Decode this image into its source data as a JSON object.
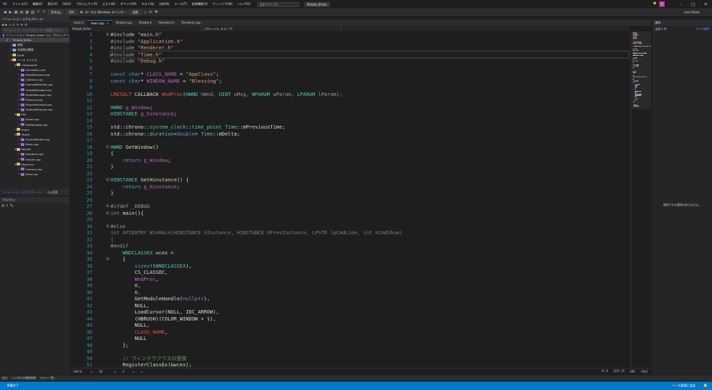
{
  "titlebar": {
    "menus": [
      "ファイル(F)",
      "編集(E)",
      "表示(V)",
      "Git(G)",
      "プロジェクト(P)",
      "ビルド(B)",
      "デバッグ(D)",
      "テスト(S)",
      "分析(N)",
      "ツール(T)",
      "拡張機能(X)",
      "ウィンドウ(W)",
      "ヘルプ(H)"
    ],
    "search_placeholder": "検索 (Ctrl+Q)",
    "solution_name": "Pinball_Strike",
    "user_initial": "田"
  },
  "toolbar": {
    "config": "Debug",
    "platform": "x64",
    "run_label": "ローカル Windows デバッガー",
    "auto": "自動",
    "live_share": "Live Share"
  },
  "solution_explorer": {
    "title": "ソリューション エクスプローラー",
    "search_placeholder": "ソリューション エクスプローラー の検索 (Ctrl+;)",
    "items": [
      {
        "label": "ソリューション 'Pinball_Strike' (1/1 プロジェクト)",
        "indent": 0,
        "icon": "sol",
        "arrow": ""
      },
      {
        "label": "Pinball_Strike",
        "indent": 1,
        "icon": "proj",
        "arrow": "◢",
        "selected": true
      },
      {
        "label": "参照",
        "indent": 2,
        "icon": "ref",
        "arrow": "▷"
      },
      {
        "label": "外部依存関係",
        "indent": 2,
        "icon": "ref",
        "arrow": "▷"
      },
      {
        "label": "JSON",
        "indent": 2,
        "icon": "folder",
        "arrow": "▷"
      },
      {
        "label": "ソース ファイル",
        "indent": 2,
        "icon": "folder",
        "arrow": "◢"
      },
      {
        "label": "Component",
        "indent": 3,
        "icon": "folder",
        "arrow": "◢"
      },
      {
        "label": "Animation.cpp",
        "indent": 4,
        "icon": "cpp",
        "arrow": "▷"
      },
      {
        "label": "BossBehavior.cpp",
        "indent": 4,
        "icon": "cpp",
        "arrow": "▷"
      },
      {
        "label": "Collision.cpp",
        "indent": 4,
        "icon": "cpp",
        "arrow": "▷"
      },
      {
        "label": "EnemyBehavior.cpp",
        "indent": 4,
        "icon": "cpp",
        "arrow": "▷"
      },
      {
        "label": "ImageManager.cpp",
        "indent": 4,
        "icon": "cpp",
        "arrow": "▷"
      },
      {
        "label": "ModelManager.cpp",
        "indent": 4,
        "icon": "cpp",
        "arrow": "▷"
      },
      {
        "label": "Physical.cpp",
        "indent": 4,
        "icon": "cpp",
        "arrow": "▷"
      },
      {
        "label": "PlayerBehavior.cpp",
        "indent": 4,
        "icon": "cpp",
        "arrow": "▷"
      },
      {
        "label": "SoldierBehavior.cpp",
        "indent": 4,
        "icon": "cpp",
        "arrow": "▷"
      },
      {
        "label": "File",
        "indent": 3,
        "icon": "folder",
        "arrow": "◢"
      },
      {
        "label": "Asset.cpp",
        "indent": 4,
        "icon": "cpp",
        "arrow": "▷"
      },
      {
        "label": "FileManager.cpp",
        "indent": 4,
        "icon": "cpp",
        "arrow": "▷"
      },
      {
        "label": "Imgui",
        "indent": 3,
        "icon": "folder",
        "arrow": "▷"
      },
      {
        "label": "Model",
        "indent": 3,
        "icon": "folder",
        "arrow": "◢"
      },
      {
        "label": "AssimpModel.cpp",
        "indent": 4,
        "icon": "cpp",
        "arrow": "▷"
      },
      {
        "label": "Mesh.cpp",
        "indent": 4,
        "icon": "cpp",
        "arrow": "▷"
      },
      {
        "label": "Render",
        "indent": 3,
        "icon": "folder",
        "arrow": "◢"
      },
      {
        "label": "Renderer.cpp",
        "indent": 4,
        "icon": "cpp",
        "arrow": "▷"
      },
      {
        "label": "Shader.cpp",
        "indent": 4,
        "icon": "cpp",
        "arrow": "▷"
      },
      {
        "label": "Resource",
        "indent": 3,
        "icon": "folder",
        "arrow": "◢"
      },
      {
        "label": "Camera.cpp",
        "indent": 4,
        "icon": "cpp",
        "arrow": "▷"
      },
      {
        "label": "Dust.cpp",
        "indent": 4,
        "icon": "cpp",
        "arrow": "▷"
      }
    ]
  },
  "left_tabs": [
    "ソリューション エクスプローラー",
    "Git 変更"
  ],
  "properties": {
    "title": "プロパティ"
  },
  "doc_tabs": [
    {
      "label": "main.h",
      "active": false
    },
    {
      "label": "main.cpp",
      "active": true
    },
    {
      "label": "Shader.cpp",
      "active": false
    },
    {
      "label": "Shader.h",
      "active": false
    },
    {
      "label": "Renderer.h",
      "active": false
    },
    {
      "label": "Renderer.cpp",
      "active": false
    }
  ],
  "nav_bar": {
    "project": "Pinball_Strike",
    "scope": "(グローバル スコープ)"
  },
  "editor": {
    "current_line": 4,
    "lines": [
      {
        "n": 1,
        "fold": "⊟",
        "t": [
          [
            "#include \"main.h\"",
            "#c8c8c8"
          ]
        ]
      },
      {
        "n": 2,
        "fold": "",
        "t": [
          [
            "#include ",
            "#9b9b9b"
          ],
          [
            "\"Application.h\"",
            "#d69d85"
          ]
        ]
      },
      {
        "n": 3,
        "fold": "",
        "t": [
          [
            "#include ",
            "#9b9b9b"
          ],
          [
            "\"Renderer.h\"",
            "#d69d85"
          ]
        ]
      },
      {
        "n": 4,
        "fold": "",
        "t": [
          [
            "#include ",
            "#9b9b9b"
          ],
          [
            "\"Time.h\"",
            "#d69d85"
          ]
        ]
      },
      {
        "n": 5,
        "fold": "",
        "t": [
          [
            "#include ",
            "#9b9b9b"
          ],
          [
            "\"Debug.h\"",
            "#d69d85"
          ]
        ]
      },
      {
        "n": 6,
        "fold": "",
        "t": []
      },
      {
        "n": 7,
        "fold": "",
        "t": [
          [
            "const ",
            "#569cd6"
          ],
          [
            "char",
            "#569cd6"
          ],
          [
            "* ",
            "#dcdcdc"
          ],
          [
            "CLASS_NAME",
            "#bd63c5"
          ],
          [
            " = ",
            "#dcdcdc"
          ],
          [
            "\"AppClass\"",
            "#d69d85"
          ],
          [
            ";",
            "#dcdcdc"
          ]
        ]
      },
      {
        "n": 8,
        "fold": "",
        "t": [
          [
            "const ",
            "#569cd6"
          ],
          [
            "char",
            "#569cd6"
          ],
          [
            "* ",
            "#dcdcdc"
          ],
          [
            "WINDOW_NAME",
            "#bd63c5"
          ],
          [
            " = ",
            "#dcdcdc"
          ],
          [
            "\"Blessing\"",
            "#d69d85"
          ],
          [
            ";",
            "#dcdcdc"
          ]
        ]
      },
      {
        "n": 9,
        "fold": "",
        "t": []
      },
      {
        "n": 10,
        "fold": "",
        "t": [
          [
            "LRESULT",
            "#e05252"
          ],
          [
            " CALLBACK ",
            "#dcdcdc"
          ],
          [
            "WndProc",
            "#e05252"
          ],
          [
            "(",
            "#dcdcdc"
          ],
          [
            "HWND",
            "#4ec9b0"
          ],
          [
            " hWnd, ",
            "#9a9a9a"
          ],
          [
            "UINT",
            "#4ec9b0"
          ],
          [
            " uMsg, ",
            "#9a9a9a"
          ],
          [
            "WPARAM",
            "#4ec9b0"
          ],
          [
            " wParam, ",
            "#9a9a9a"
          ],
          [
            "LPARAM",
            "#4ec9b0"
          ],
          [
            " lParam);",
            "#9a9a9a"
          ]
        ]
      },
      {
        "n": 11,
        "fold": "",
        "t": []
      },
      {
        "n": 12,
        "fold": "",
        "t": [
          [
            "HWND",
            "#4ec9b0"
          ],
          [
            " ",
            "#dcdcdc"
          ],
          [
            "g_Window",
            "#bd63c5"
          ],
          [
            ";",
            "#dcdcdc"
          ]
        ]
      },
      {
        "n": 13,
        "fold": "",
        "t": [
          [
            "HINSTANCE",
            "#4ec9b0"
          ],
          [
            " ",
            "#dcdcdc"
          ],
          [
            "g_hinstance",
            "#bd63c5"
          ],
          [
            ";",
            "#dcdcdc"
          ]
        ]
      },
      {
        "n": 14,
        "fold": "",
        "t": []
      },
      {
        "n": 15,
        "fold": "",
        "t": [
          [
            "std::chrono::",
            "#dcdcdc"
          ],
          [
            "system_clock",
            "#4ec9b0"
          ],
          [
            "::",
            "#dcdcdc"
          ],
          [
            "time_point",
            "#4ec9b0"
          ],
          [
            " ",
            "#dcdcdc"
          ],
          [
            "Time",
            "#4ec9b0"
          ],
          [
            "::mPreviousTime;",
            "#dcdcdc"
          ]
        ]
      },
      {
        "n": 16,
        "fold": "",
        "t": [
          [
            "std::chrono::",
            "#dcdcdc"
          ],
          [
            "duration",
            "#4ec9b0"
          ],
          [
            "<",
            "#dcdcdc"
          ],
          [
            "double",
            "#569cd6"
          ],
          [
            "> ",
            "#dcdcdc"
          ],
          [
            "Time",
            "#4ec9b0"
          ],
          [
            "::mDelta;",
            "#dcdcdc"
          ]
        ]
      },
      {
        "n": 17,
        "fold": "",
        "t": []
      },
      {
        "n": 18,
        "fold": "⊟",
        "t": [
          [
            "HWND",
            "#4ec9b0"
          ],
          [
            " ",
            "#dcdcdc"
          ],
          [
            "GetWindow",
            "#dcdcaa"
          ],
          [
            "()",
            "#dcdcdc"
          ]
        ]
      },
      {
        "n": 19,
        "fold": "",
        "t": [
          [
            "{",
            "#dcdcdc"
          ]
        ]
      },
      {
        "n": 20,
        "fold": "",
        "t": [
          [
            "    return ",
            "#569cd6"
          ],
          [
            "g_Window",
            "#bd63c5"
          ],
          [
            ";",
            "#dcdcdc"
          ]
        ]
      },
      {
        "n": 21,
        "fold": "",
        "t": [
          [
            "}",
            "#dcdcdc"
          ]
        ]
      },
      {
        "n": 22,
        "fold": "",
        "t": []
      },
      {
        "n": 23,
        "fold": "⊟",
        "t": [
          [
            "HINSTANCE",
            "#4ec9b0"
          ],
          [
            " ",
            "#dcdcdc"
          ],
          [
            "GetHinstance",
            "#dcdcaa"
          ],
          [
            "() {",
            "#dcdcdc"
          ]
        ]
      },
      {
        "n": 24,
        "fold": "",
        "t": [
          [
            "    return ",
            "#569cd6"
          ],
          [
            "g_hinstance",
            "#bd63c5"
          ],
          [
            ";",
            "#dcdcdc"
          ]
        ]
      },
      {
        "n": 25,
        "fold": "",
        "t": [
          [
            "}",
            "#dcdcdc"
          ]
        ]
      },
      {
        "n": 26,
        "fold": "",
        "t": []
      },
      {
        "n": 27,
        "fold": "⊟",
        "t": [
          [
            "#ifdef _DEBUG",
            "#9b9b9b"
          ]
        ]
      },
      {
        "n": 28,
        "fold": "⊟",
        "t": [
          [
            "int",
            "#569cd6"
          ],
          [
            " ",
            "#dcdcdc"
          ],
          [
            "main",
            "#dcdcaa"
          ],
          [
            "(){",
            "#dcdcdc"
          ]
        ]
      },
      {
        "n": 29,
        "fold": "",
        "t": []
      },
      {
        "n": 30,
        "fold": "⊟",
        "t": [
          [
            "#else",
            "#9b9b9b"
          ]
        ]
      },
      {
        "n": 31,
        "fold": "",
        "t": [
          [
            "int APIENTRY WinMain(HINSTANCE hInstance, HINSTANCE hPrevInstance, LPSTR lpCmdLine, int nCmdShow)",
            "#7f7f7f"
          ]
        ]
      },
      {
        "n": 32,
        "fold": "",
        "t": [
          [
            "{",
            "#7f7f7f"
          ]
        ]
      },
      {
        "n": 33,
        "fold": "",
        "t": [
          [
            "#endif",
            "#9b9b9b"
          ]
        ]
      },
      {
        "n": 34,
        "fold": "",
        "t": [
          [
            "    WNDCLASSEX",
            "#4ec9b0"
          ],
          [
            " ",
            "#dcdcdc"
          ],
          [
            "wcex",
            "#9cdcfe"
          ],
          [
            " =",
            "#dcdcdc"
          ]
        ]
      },
      {
        "n": 35,
        "fold": "⊟",
        "t": [
          [
            "    {",
            "#dcdcdc"
          ]
        ]
      },
      {
        "n": 36,
        "fold": "",
        "t": [
          [
            "        ",
            "#dcdcdc"
          ],
          [
            "sizeof",
            "#569cd6"
          ],
          [
            "(",
            "#dcdcdc"
          ],
          [
            "WNDCLASSEX",
            "#4ec9b0"
          ],
          [
            "),",
            "#dcdcdc"
          ]
        ]
      },
      {
        "n": 37,
        "fold": "",
        "t": [
          [
            "        CS_CLASSDC,",
            "#dcdcdc"
          ]
        ]
      },
      {
        "n": 38,
        "fold": "",
        "t": [
          [
            "        ",
            "#dcdcdc"
          ],
          [
            "WndProc",
            "#bd63c5"
          ],
          [
            ",",
            "#dcdcdc"
          ]
        ]
      },
      {
        "n": 39,
        "fold": "",
        "t": [
          [
            "        0,",
            "#b5cea8"
          ]
        ]
      },
      {
        "n": 40,
        "fold": "",
        "t": [
          [
            "        0,",
            "#b5cea8"
          ]
        ]
      },
      {
        "n": 41,
        "fold": "",
        "t": [
          [
            "        GetModuleHandle(",
            "#dcdcdc"
          ],
          [
            "nullptr",
            "#569cd6"
          ],
          [
            "),",
            "#dcdcdc"
          ]
        ]
      },
      {
        "n": 42,
        "fold": "",
        "t": [
          [
            "        NULL,",
            "#dcdcdc"
          ]
        ]
      },
      {
        "n": 43,
        "fold": "",
        "t": [
          [
            "        LoadCursor(NULL, IDC_ARROW),",
            "#dcdcdc"
          ]
        ]
      },
      {
        "n": 44,
        "fold": "",
        "t": [
          [
            "        (HBRUSH)(COLOR_WINDOW + 1),",
            "#dcdcdc"
          ]
        ]
      },
      {
        "n": 45,
        "fold": "",
        "t": [
          [
            "        NULL,",
            "#dcdcdc"
          ]
        ]
      },
      {
        "n": 46,
        "fold": "",
        "t": [
          [
            "        ",
            "#dcdcdc"
          ],
          [
            "CLASS_NAME",
            "#e05252"
          ],
          [
            ",",
            "#dcdcdc"
          ]
        ]
      },
      {
        "n": 47,
        "fold": "",
        "t": [
          [
            "        NULL",
            "#dcdcdc"
          ]
        ]
      },
      {
        "n": 48,
        "fold": "",
        "t": [
          [
            "    };",
            "#dcdcdc"
          ]
        ]
      },
      {
        "n": 49,
        "fold": "",
        "t": []
      },
      {
        "n": 50,
        "fold": "",
        "t": [
          [
            "    // ウィンドウクラスの登録",
            "#57a64a"
          ]
        ]
      },
      {
        "n": 51,
        "fold": "",
        "t": [
          [
            "    RegisterClassEx(&wcex);",
            "#dcdcdc"
          ]
        ]
      }
    ]
  },
  "editor_status": {
    "zoom": "140 %",
    "errors": "16",
    "warnings": "1",
    "line": "行: 4",
    "char": "文字: 15",
    "encoding": "SPC",
    "eol": "CRLF"
  },
  "notifications": {
    "title": "通知",
    "count": "全部 0 件",
    "clear": "すべて削除",
    "empty": "使用できる通知はありません。"
  },
  "bottom_tabs": [
    "出力",
    "シンボルの検索結果",
    "エラー一覧..."
  ],
  "statusbar": {
    "text": "準備完了",
    "source_control": "ソース管理に追加"
  },
  "colors": {
    "accent": "#007acc",
    "editor_bg": "#1e1e1e",
    "panel_bg": "#252526"
  }
}
